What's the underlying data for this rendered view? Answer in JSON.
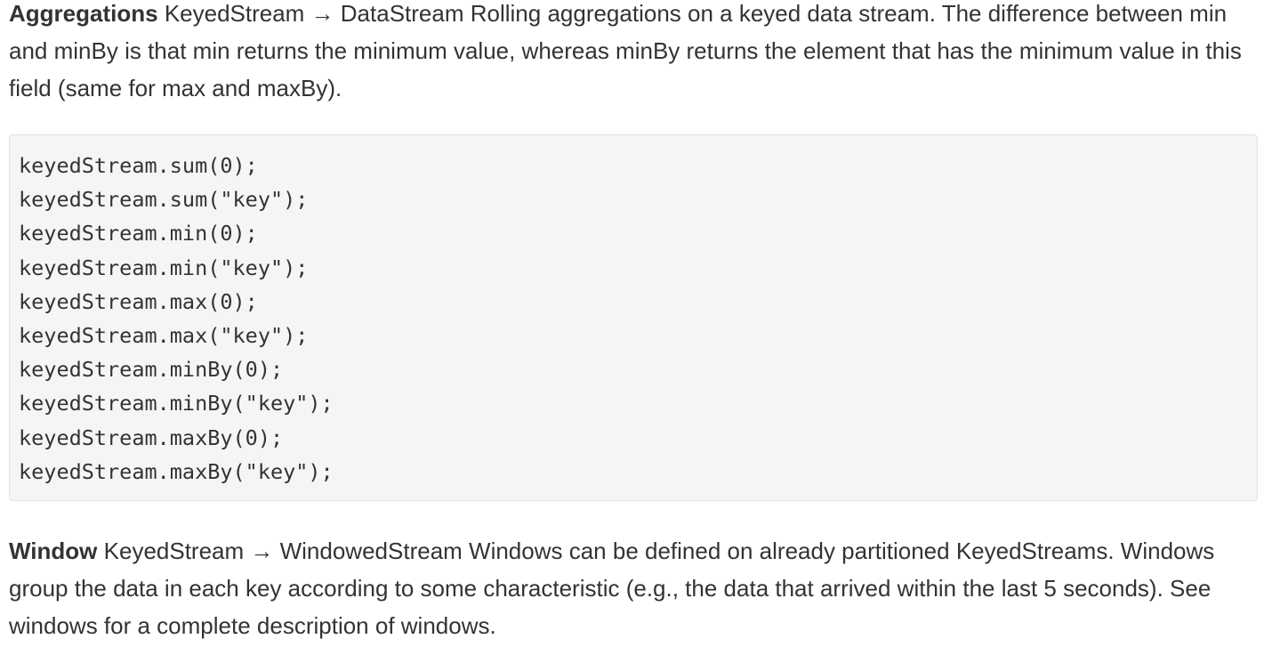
{
  "sections": [
    {
      "term": "Aggregations",
      "description": "KeyedStream → DataStream Rolling aggregations on a keyed data stream. The difference between min and minBy is that min returns the minimum value, whereas minBy returns the element that has the minimum value in this field (same for max and maxBy)."
    },
    {
      "term": "Window",
      "description": "KeyedStream → WindowedStream Windows can be defined on already partitioned KeyedStreams. Windows group the data in each key according to some characteristic (e.g., the data that arrived within the last 5 seconds). See windows for a complete description of windows."
    }
  ],
  "code": {
    "lines": [
      "keyedStream.sum(0);",
      "keyedStream.sum(\"key\");",
      "keyedStream.min(0);",
      "keyedStream.min(\"key\");",
      "keyedStream.max(0);",
      "keyedStream.max(\"key\");",
      "keyedStream.minBy(0);",
      "keyedStream.minBy(\"key\");",
      "keyedStream.maxBy(0);",
      "keyedStream.maxBy(\"key\");"
    ]
  }
}
